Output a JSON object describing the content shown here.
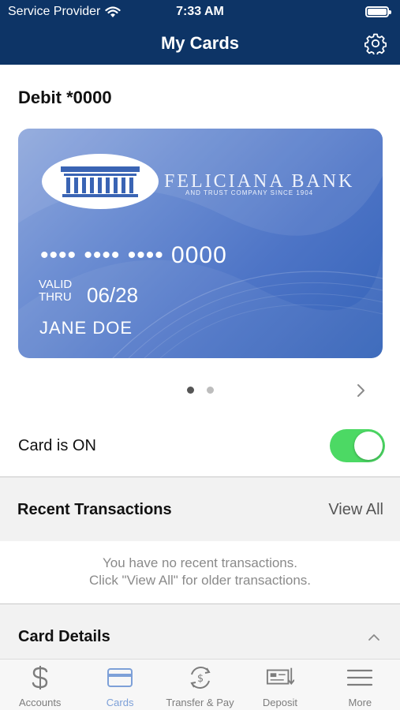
{
  "status_bar": {
    "carrier": "Service Provider",
    "time": "7:33 AM"
  },
  "nav": {
    "title": "My Cards",
    "settings_icon": "gear-icon"
  },
  "card_section": {
    "heading": "Debit *0000",
    "card": {
      "bank_name": "FELICIANA BANK",
      "bank_subtitle": "AND TRUST COMPANY  SINCE 1904",
      "number_masked": "••••  ••••  ••••  0000",
      "valid_label_line1": "VALID",
      "valid_label_line2": "THRU",
      "expiry": "06/28",
      "cardholder": "JANE DOE"
    },
    "pager": {
      "count": 2,
      "active_index": 0
    }
  },
  "card_toggle": {
    "label": "Card is ON",
    "on": true
  },
  "recent_transactions": {
    "title": "Recent Transactions",
    "view_all_label": "View All",
    "empty_line1": "You have no recent transactions.",
    "empty_line2": "Click \"View All\" for older transactions."
  },
  "card_details": {
    "title": "Card Details",
    "expanded": true
  },
  "tabbar": {
    "tabs": [
      {
        "label": "Accounts",
        "icon": "dollar-icon",
        "active": false
      },
      {
        "label": "Cards",
        "icon": "card-icon",
        "active": true
      },
      {
        "label": "Transfer & Pay",
        "icon": "transfer-icon",
        "active": false
      },
      {
        "label": "Deposit",
        "icon": "deposit-check-icon",
        "active": false
      },
      {
        "label": "More",
        "icon": "menu-icon",
        "active": false
      }
    ]
  },
  "colors": {
    "header_bg": "#0d3466",
    "toggle_on": "#4cd964",
    "tab_active": "#7da0d8",
    "tab_inactive": "#7d7d7d"
  }
}
